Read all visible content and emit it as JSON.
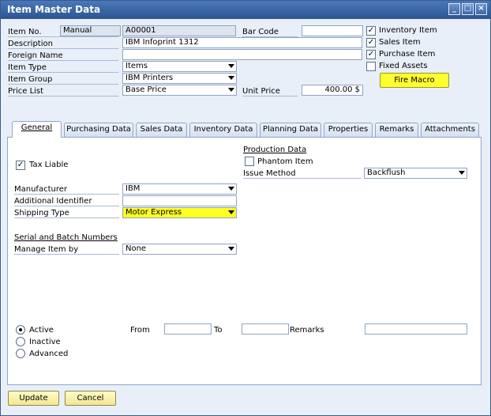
{
  "window": {
    "title": "Item Master Data",
    "buttons": [
      "_",
      "□",
      "×"
    ]
  },
  "header": {
    "item_no_label": "Item No.",
    "item_no_series": "Manual",
    "item_no_value": "A00001",
    "description_label": "Description",
    "description_value": "IBM Infoprint 1312",
    "foreign_name_label": "Foreign Name",
    "foreign_name_value": "",
    "item_type_label": "Item Type",
    "item_type_value": "Items",
    "item_group_label": "Item Group",
    "item_group_value": "IBM Printers",
    "price_list_label": "Price List",
    "price_list_value": "Base Price",
    "bar_code_label": "Bar Code",
    "bar_code_value": "",
    "unit_price_label": "Unit Price",
    "unit_price_value": "400.00 $",
    "inventory_item": "Inventory Item",
    "sales_item": "Sales Item",
    "purchase_item": "Purchase Item",
    "fixed_assets": "Fixed Assets",
    "fire_macro": "Fire Macro",
    "check_mark": "✓"
  },
  "tabs": [
    "General",
    "Purchasing Data",
    "Sales Data",
    "Inventory Data",
    "Planning Data",
    "Properties",
    "Remarks",
    "Attachments"
  ],
  "general": {
    "tax_liable": "Tax Liable",
    "production_data": "Production Data",
    "phantom_item": "Phantom Item",
    "issue_method_label": "Issue Method",
    "issue_method_value": "Backflush",
    "manufacturer_label": "Manufacturer",
    "manufacturer_value": "IBM",
    "additional_identifier_label": "Additional Identifier",
    "additional_identifier_value": "",
    "shipping_type_label": "Shipping Type",
    "shipping_type_value": "Motor Express",
    "serial_batch_heading": "Serial and Batch Numbers",
    "manage_item_by_label": "Manage Item by",
    "manage_item_by_value": "None",
    "active": "Active",
    "inactive": "Inactive",
    "advanced": "Advanced",
    "from_label": "From",
    "to_label": "To",
    "remarks_label": "Remarks"
  },
  "footer": {
    "update": "Update",
    "cancel": "Cancel"
  }
}
